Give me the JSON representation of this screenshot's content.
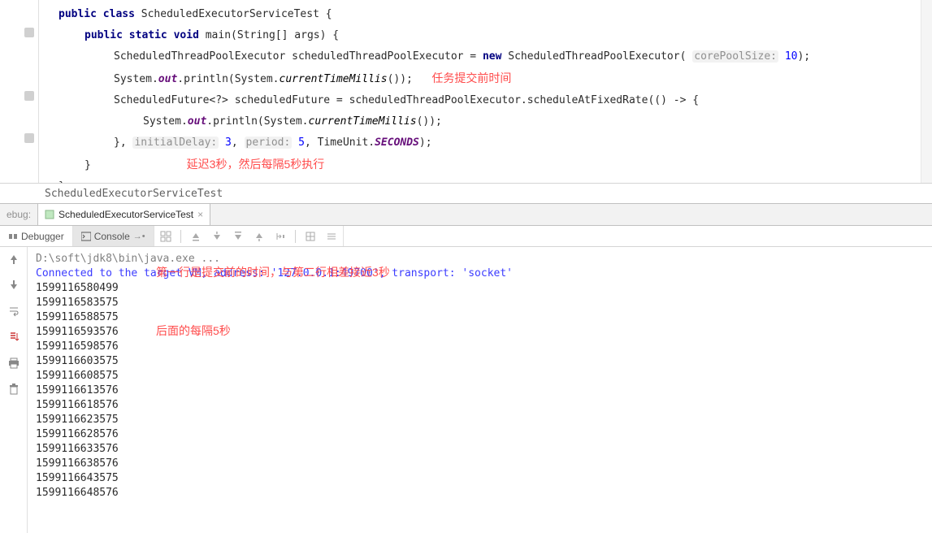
{
  "code": {
    "l1_kw1": "public",
    "l1_kw2": "class",
    "l1_cls": "ScheduledExecutorServiceTest {",
    "l2_kw1": "public",
    "l2_kw2": "static",
    "l2_kw3": "void",
    "l2_rest": "main(String[] args) {",
    "l3_a": "ScheduledThreadPoolExecutor scheduledThreadPoolExecutor = ",
    "l3_new": "new",
    "l3_b": " ScheduledThreadPoolExecutor(",
    "l3_hint": "corePoolSize:",
    "l3_val": " 10",
    "l3_c": ");",
    "l4_a": "System.",
    "l4_out": "out",
    "l4_b": ".println(System.",
    "l4_ct": "currentTimeMillis",
    "l4_c": "());",
    "l4_annot": "任务提交前时间",
    "l5_a": "ScheduledFuture<?> scheduledFuture = scheduledThreadPoolExecutor.scheduleAtFixedRate(() -> {",
    "l6_a": "System.",
    "l6_out": "out",
    "l6_b": ".println(System.",
    "l6_ct": "currentTimeMillis",
    "l6_c": "());",
    "l7_a": "}, ",
    "l7_h1": "initialDelay:",
    "l7_v1": " 3",
    "l7_b": ", ",
    "l7_h2": "period:",
    "l7_v2": " 5",
    "l7_c": ", TimeUnit.",
    "l7_sec": "SECONDS",
    "l7_d": ");",
    "l8": "}",
    "l9": "延迟3秒，然后每隔5秒执行",
    "l10": "}"
  },
  "breadcrumb": "ScheduledExecutorServiceTest",
  "debug": {
    "label": "ebug:",
    "tab": "ScheduledExecutorServiceTest"
  },
  "subtabs": {
    "debugger": "Debugger",
    "console": "Console"
  },
  "console": {
    "exe": "D:\\soft\\jdk8\\bin\\java.exe ...",
    "vm": "Connected to the target VM, address: '127.0.0.1:49700', transport: 'socket'",
    "ts": [
      "1599116580499",
      "1599116583575",
      "1599116588575",
      "1599116593576",
      "1599116598576",
      "1599116603575",
      "1599116608575",
      "1599116613576",
      "1599116618576",
      "1599116623575",
      "1599116628576",
      "1599116633576",
      "1599116638576",
      "1599116643575",
      "1599116648576"
    ],
    "annot1": "第一行是提交前的时间，与第二行相差接近3秒",
    "annot2": "后面的每隔5秒"
  }
}
